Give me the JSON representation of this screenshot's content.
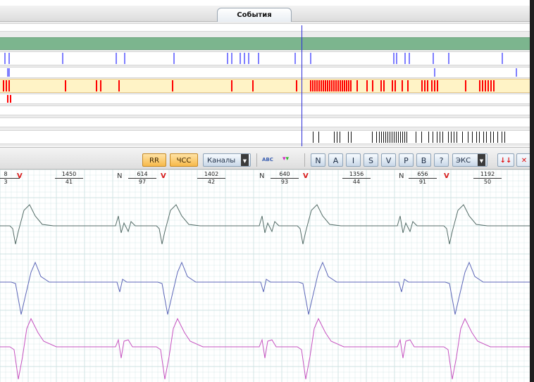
{
  "events": {
    "tab_label": "События"
  },
  "toolbar": {
    "rr_label": "RR",
    "hr_label": "ЧСС",
    "channels_label": "Каналы",
    "abc_label": "ABC",
    "letters": [
      "N",
      "A",
      "I",
      "S",
      "V",
      "P",
      "B",
      "?"
    ],
    "ex_label": "ЭКС"
  },
  "ecg": {
    "beat_marks": [
      {
        "type": "V",
        "text": "V"
      },
      {
        "type": "N",
        "text": "N"
      },
      {
        "type": "V",
        "text": "V"
      },
      {
        "type": "N",
        "text": "N"
      },
      {
        "type": "V",
        "text": "V"
      },
      {
        "type": "N",
        "text": "N"
      },
      {
        "type": "V",
        "text": "V"
      }
    ],
    "intervals": [
      {
        "top": "8",
        "bottom": "3"
      },
      {
        "top": "1450",
        "bottom": "41"
      },
      {
        "top": "614",
        "bottom": "97"
      },
      {
        "top": "1402",
        "bottom": "42"
      },
      {
        "top": "640",
        "bottom": "93"
      },
      {
        "top": "1356",
        "bottom": "44"
      },
      {
        "top": "656",
        "bottom": "91"
      },
      {
        "top": "1192",
        "bottom": "50"
      }
    ],
    "lead_colors": [
      "#556d68",
      "#5c66b8",
      "#c653c0"
    ],
    "grid_color": "#cfe3e3"
  },
  "colors": {
    "green_track": "#7cb58e",
    "blue_marks": "#7f7fff",
    "yellow_track": "#fff3c6",
    "red_marks": "#ff0000",
    "cursor": "#2c2cd8"
  }
}
